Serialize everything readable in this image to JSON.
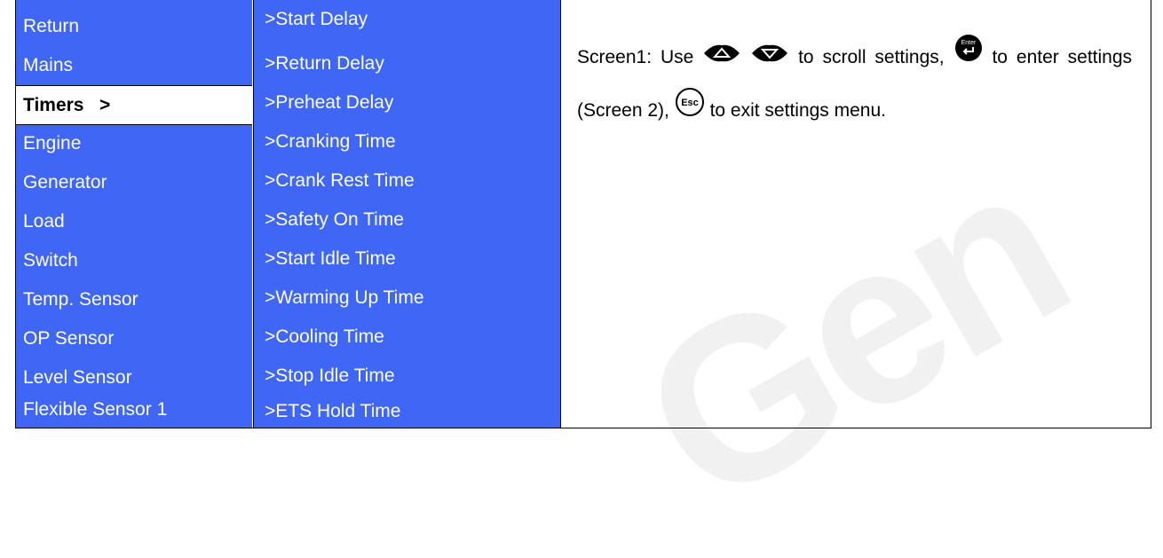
{
  "menu": {
    "items": [
      "Return",
      "Mains",
      "Timers   >",
      "Engine",
      "Generator",
      "Load",
      "Switch",
      "Temp. Sensor",
      "OP Sensor",
      "Level Sensor",
      "Flexible Sensor 1"
    ]
  },
  "submenu": {
    "items": [
      ">Start Delay",
      ">Return Delay",
      ">Preheat Delay",
      ">Cranking Time",
      ">Crank Rest Time",
      ">Safety On Time",
      ">Start Idle Time",
      ">Warming Up Time",
      ">Cooling Time",
      ">Stop Idle Time",
      ">ETS Hold Time"
    ]
  },
  "description": {
    "part1": "Screen1: Use",
    "part2": "to scroll settings,",
    "part3": "to enter settings (Screen 2),",
    "part4": "to exit settings menu."
  },
  "icons": {
    "up": "up-arrow-button-icon",
    "down": "down-arrow-button-icon",
    "enter": "enter-button-icon",
    "enter_label": "Enter",
    "esc": "esc-button-icon",
    "esc_label": "Esc"
  },
  "watermark": "Gen",
  "colors": {
    "menu_bg": "#3f66f4",
    "menu_text": "#ffffff",
    "selected_bg": "#ffffff"
  }
}
